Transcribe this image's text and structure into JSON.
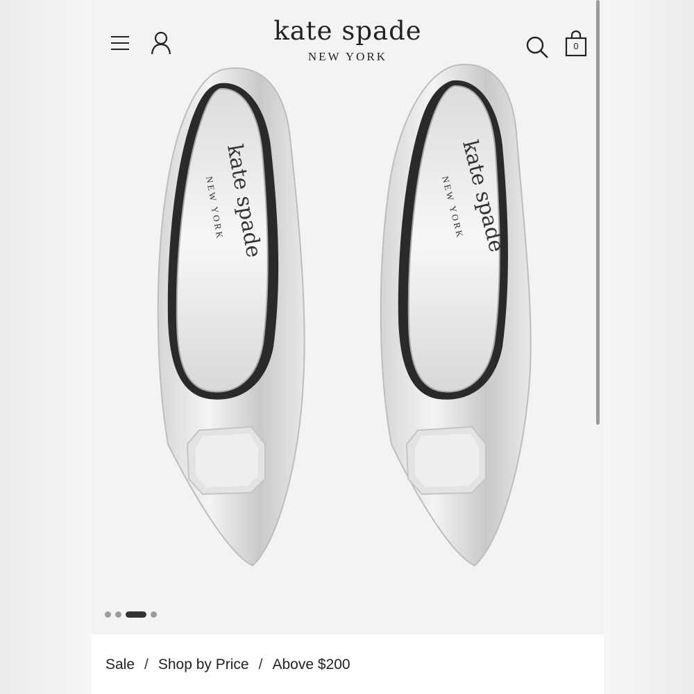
{
  "brand": {
    "name": "kate spade",
    "tagline": "NEW YORK"
  },
  "header": {
    "bag_count": "0"
  },
  "product": {
    "insole_brand": "kate spade",
    "insole_tagline": "NEW YORK",
    "gallery_dots": 4,
    "active_dot": 2
  },
  "breadcrumb": {
    "items": [
      "Sale",
      "Shop by Price",
      "Above $200"
    ],
    "separator": "/"
  },
  "icons": [
    "menu-icon",
    "account-icon",
    "search-icon",
    "shopping-bag-icon"
  ],
  "colors": {
    "text": "#222222",
    "background": "#f3f3f3"
  }
}
